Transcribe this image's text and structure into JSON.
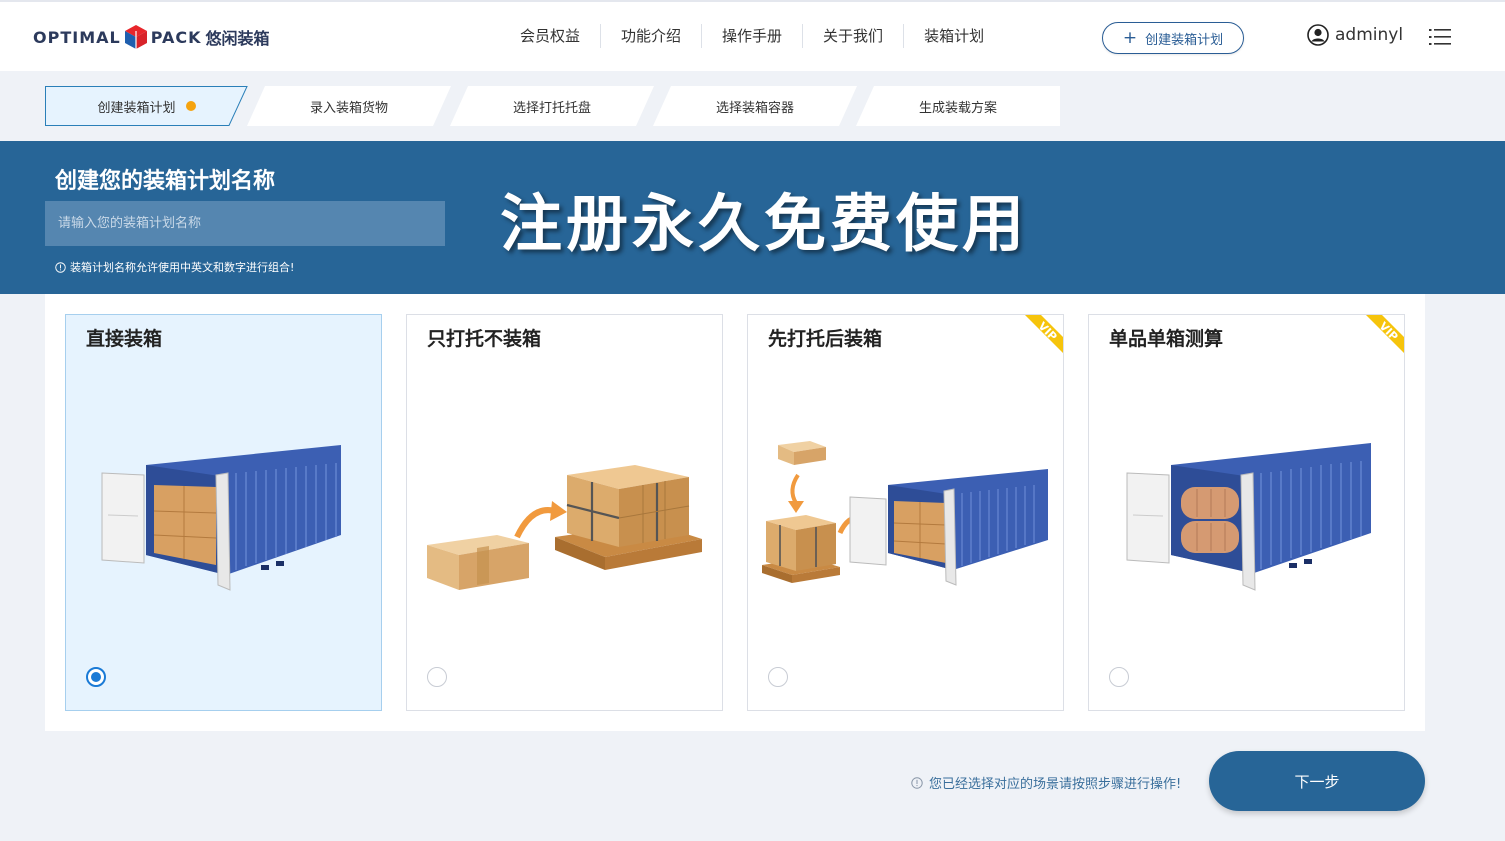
{
  "logo": {
    "text_left": "OPTIMAL",
    "text_right": "PACK",
    "cn": "悠闲装箱"
  },
  "nav": [
    "会员权益",
    "功能介绍",
    "操作手册",
    "关于我们",
    "装箱计划"
  ],
  "create_button": {
    "label": "创建装箱计划"
  },
  "user": {
    "name": "adminyl"
  },
  "steps": [
    {
      "label": "创建装箱计划",
      "active": true
    },
    {
      "label": "录入装箱货物"
    },
    {
      "label": "选择打托托盘"
    },
    {
      "label": "选择装箱容器"
    },
    {
      "label": "生成装载方案"
    }
  ],
  "banner": {
    "title": "创建您的装箱计划名称",
    "input_placeholder": "请输入您的装箱计划名称",
    "hint": "装箱计划名称允许使用中英文和数字进行组合!",
    "promo": "注册永久免费使用"
  },
  "cards": [
    {
      "title": "直接装箱",
      "selected": true,
      "vip": false
    },
    {
      "title": "只打托不装箱",
      "selected": false,
      "vip": false
    },
    {
      "title": "先打托后装箱",
      "selected": false,
      "vip": true
    },
    {
      "title": "单品单箱测算",
      "selected": false,
      "vip": true
    }
  ],
  "vip_label": "VIP",
  "footer": {
    "hint": "您已经选择对应的场景请按照步骤进行操作!",
    "next_label": "下一步"
  },
  "colors": {
    "primary": "#276597",
    "accent": "#f5a30f",
    "selected_bg": "#e6f3fe",
    "vip": "#f6c40c"
  }
}
